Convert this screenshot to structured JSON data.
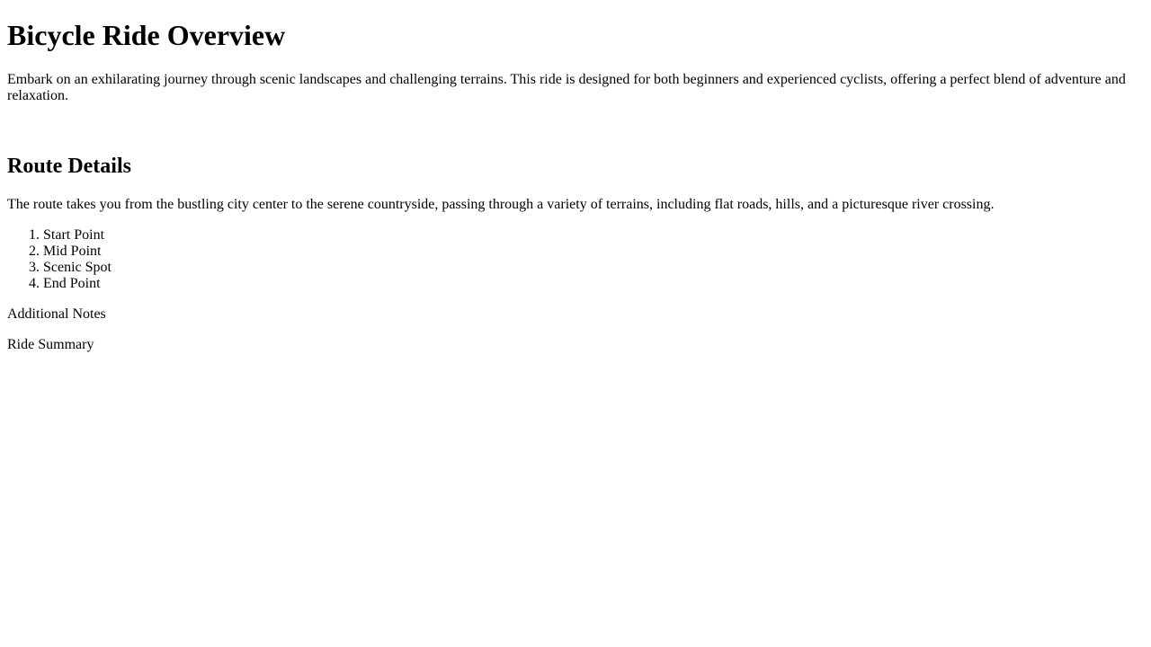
{
  "page": {
    "title": "Bicycle Ride Overview",
    "intro": "Embark on an exhilarating journey through scenic landscapes and challenging terrains. This ride is designed for both beginners and experienced cyclists, offering a perfect blend of adventure and relaxation."
  },
  "route": {
    "heading": "Route Details",
    "description": "The route takes you from the bustling city center to the serene countryside, passing through a variety of terrains, including flat roads, hills, and a picturesque river crossing.",
    "points": [
      "Start Point",
      "Mid Point",
      "Scenic Spot",
      "End Point"
    ]
  },
  "sections": {
    "additional_notes": "Additional Notes",
    "ride_summary": "Ride Summary"
  }
}
